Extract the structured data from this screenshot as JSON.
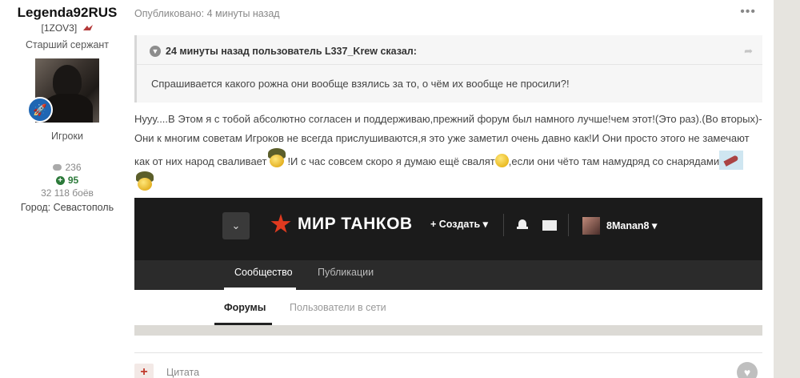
{
  "author": {
    "name": "Legenda92RUS",
    "clan": "[1ZOV3]",
    "rank": "Старший сержант",
    "group": "Игроки",
    "posts": "236",
    "reputation": "95",
    "battles": "32 118 боёв",
    "city": "Город: Севастополь"
  },
  "post": {
    "published": "Опубликовано: 4 минуты назад",
    "more_label": "•••",
    "quote": {
      "header": "24 минуты назад пользователь L337_Krew сказал:",
      "text": "Спрашивается какого рожна они вообще взялись за то, о чём их вообще не просили?!"
    },
    "text_part1": "Нууу....В Этом я с тобой абсолютно согласен и поддерживаю,прежний форум был намного лучше!чем этот!(Это раз).(Во вторых)-Они к многим советам Игроков не всегда прислушиваются,я это уже заметил очень давно как!И Они просто этого не замечают как от них народ сваливает",
    "text_part2": "!И с час совсем скоро я думаю ещё свалят",
    "text_part3": ",если они чёто там намудряд со снарядами"
  },
  "embed": {
    "logo_text": "МИР ТАНКОВ",
    "create_label": "+ Создать ▾",
    "user_name": "8Manan8 ▾",
    "tab_community": "Сообщество",
    "tab_publications": "Публикации",
    "tab_forums": "Форумы",
    "tab_online": "Пользователи в сети"
  },
  "reply": {
    "quote_label": "Цитата",
    "plus_label": "+"
  },
  "colors": {
    "accent_red": "#e03a1f",
    "rep_green": "#2c7a3a",
    "rank_blue": "#1f66b3"
  }
}
